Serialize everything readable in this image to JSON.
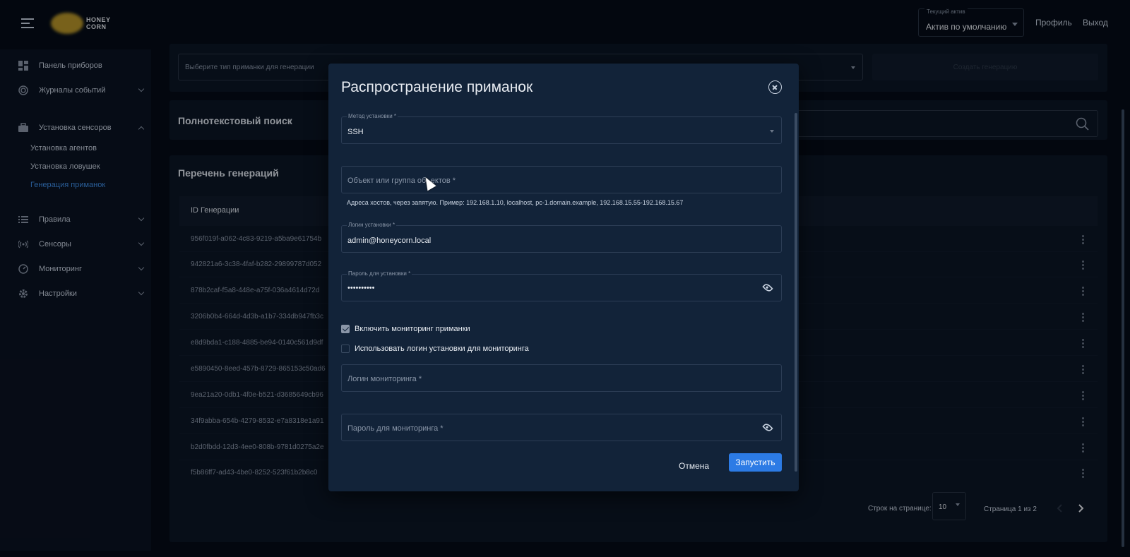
{
  "header": {
    "logo_line1": "HONEY",
    "logo_line2": "CORN",
    "asset_label": "Текущий актив",
    "asset_value": "Актив по умолчанию",
    "profile": "Профиль",
    "logout": "Выход"
  },
  "sidebar": {
    "items": [
      {
        "label": "Панель приборов",
        "icon": "dashboard-icon"
      },
      {
        "label": "Журналы событий",
        "icon": "target-icon"
      },
      {
        "label": "Установка сенсоров",
        "icon": "toolbox-icon"
      },
      {
        "label": "Правила",
        "icon": "list-icon"
      },
      {
        "label": "Сенсоры",
        "icon": "broadcast-icon"
      },
      {
        "label": "Мониторинг",
        "icon": "gauge-icon"
      },
      {
        "label": "Настройки",
        "icon": "gear-icon"
      }
    ],
    "subitems": [
      "Установка агентов",
      "Установка ловушек",
      "Генерация приманок"
    ]
  },
  "main": {
    "type_select_placeholder": "Выберите тип приманки для генерации",
    "create_button": "Создать генерацию",
    "search_title": "Полнотекстовый поиск",
    "list_title": "Перечень генераций",
    "column_id": "ID Генерации",
    "rows": [
      "956f019f-a062-4c83-9219-a5ba9e61754b",
      "942821a6-3c38-4faf-b282-29899787d052",
      "878b2caf-f5a8-448e-a75f-036a4614d72d",
      "3206b0b4-664d-4d3b-a1b7-334db947fb3c",
      "e8d9bda1-c188-4885-be94-0140c561d9df",
      "e5890450-8eed-457b-8729-865153c50ad6",
      "9ea21a20-0db1-4f0e-b521-d3685649cb96",
      "34f9abba-654b-4279-8532-e7a8318e1a91",
      "b2d0fbdd-12d3-4ee0-808b-9781d0275a2e",
      "f5b86ff7-ad43-4be0-8252-523f61b2b8c0"
    ],
    "rows_per_page_label": "Строк на странице:",
    "rows_per_page": "10",
    "page_info": "Страница 1 из 2"
  },
  "modal": {
    "title": "Распространение приманок",
    "method_label": "Метод установки *",
    "method_value": "SSH",
    "target_placeholder": "Объект или группа объектов *",
    "target_hint": "Адреса хостов, через запятую. Пример: 192.168.1.10, localhost, pc-1.domain.example, 192.168.15.55-192.168.15.67",
    "login_label": "Логин установки *",
    "login_value": "admin@honeycorn.local",
    "password_label": "Пароль для установки *",
    "password_value": "••••••••••",
    "checkbox_monitoring": "Включить мониторинг приманки",
    "checkbox_use_login": "Использовать логин установки для мониторинга",
    "monitor_login_placeholder": "Логин мониторинга *",
    "monitor_password_placeholder": "Пароль для мониторинга *",
    "cancel": "Отмена",
    "run": "Запустить"
  }
}
